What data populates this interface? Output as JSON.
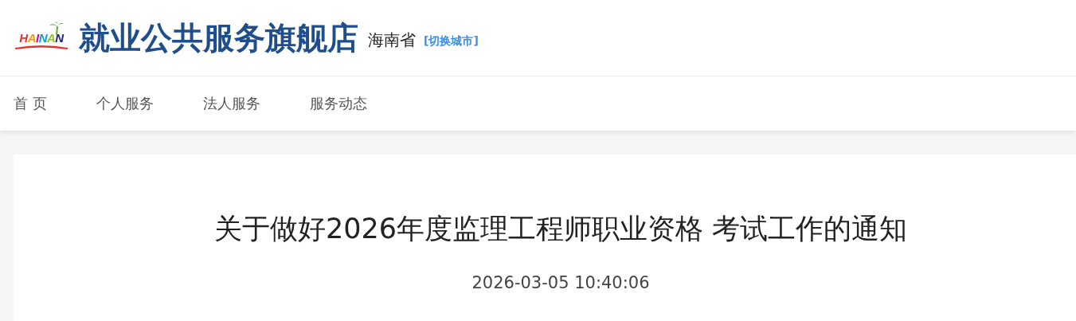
{
  "header": {
    "logo_text": "HAINAN",
    "site_title": "就业公共服务旗舰店",
    "province": "海南省",
    "switch_city": "[切换城市]"
  },
  "nav": {
    "items": [
      {
        "label": "首 页"
      },
      {
        "label": "个人服务"
      },
      {
        "label": "法人服务"
      },
      {
        "label": "服务动态"
      }
    ]
  },
  "article": {
    "title": "关于做好2026年度监理工程师职业资格 考试工作的通知",
    "date": "2026-03-05 10:40:06"
  }
}
